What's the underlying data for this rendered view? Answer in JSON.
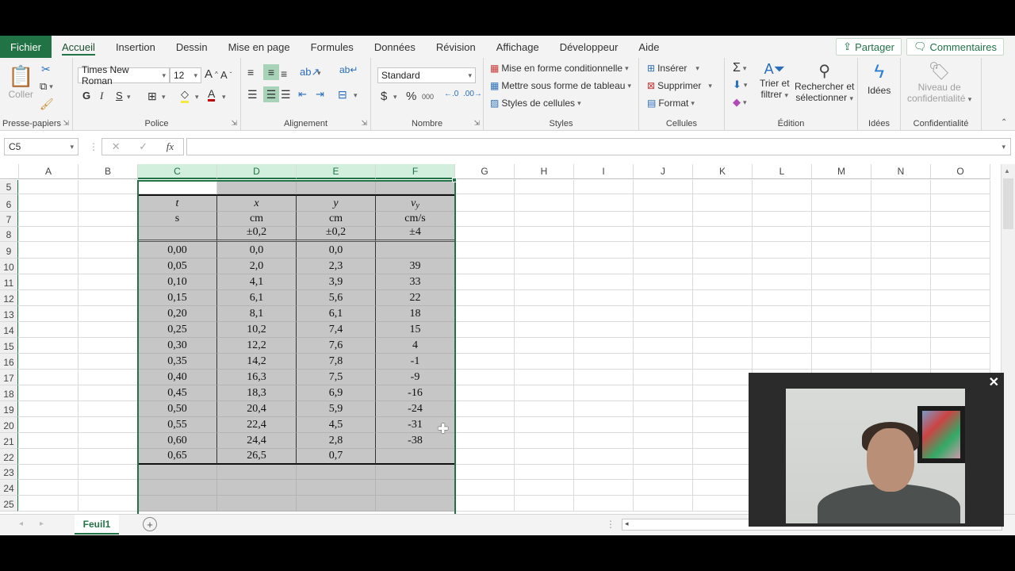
{
  "tabs": {
    "file": "Fichier",
    "items": [
      "Accueil",
      "Insertion",
      "Dessin",
      "Mise en page",
      "Formules",
      "Données",
      "Révision",
      "Affichage",
      "Développeur",
      "Aide"
    ],
    "active": "Accueil",
    "share": "Partager",
    "comments": "Commentaires"
  },
  "ribbon": {
    "clipboard": {
      "label": "Presse-papiers",
      "paste": "Coller"
    },
    "font": {
      "label": "Police",
      "family": "Times New Roman",
      "size": "12",
      "bold": "G",
      "italic": "I",
      "underline": "S"
    },
    "alignment": {
      "label": "Alignement"
    },
    "number": {
      "label": "Nombre",
      "format": "Standard",
      "currency": "$",
      "percent": "%",
      "thousands": "000"
    },
    "styles": {
      "label": "Styles",
      "conditional": "Mise en forme conditionnelle",
      "table": "Mettre sous forme de tableau",
      "cell_styles": "Styles de cellules"
    },
    "cells": {
      "label": "Cellules",
      "insert": "Insérer",
      "delete": "Supprimer",
      "format": "Format"
    },
    "editing": {
      "label": "Édition",
      "sort_line1": "Trier et",
      "sort_line2": "filtrer",
      "find_line1": "Rechercher et",
      "find_line2": "sélectionner"
    },
    "ideas": {
      "label": "Idées",
      "button": "Idées"
    },
    "sensitivity": {
      "label": "Confidentialité",
      "line1": "Niveau de",
      "line2": "confidentialité"
    }
  },
  "formula_bar": {
    "name_box": "C5",
    "fx": "fx",
    "value": ""
  },
  "grid": {
    "columns": [
      "A",
      "B",
      "C",
      "D",
      "E",
      "F",
      "G",
      "H",
      "I",
      "J",
      "K",
      "L",
      "M",
      "N",
      "O"
    ],
    "selected_columns": [
      "C",
      "D",
      "E",
      "F"
    ],
    "rows": [
      "5",
      "6",
      "7",
      "8",
      "9",
      "10",
      "11",
      "12",
      "13",
      "14",
      "15",
      "16",
      "17",
      "18",
      "19",
      "20",
      "21",
      "22",
      "23",
      "24",
      "25"
    ]
  },
  "table": {
    "headers": [
      "t",
      "x",
      "y",
      "v_y"
    ],
    "header_main": [
      "t",
      "x",
      "y",
      "v"
    ],
    "header_sub": [
      "",
      "",
      "",
      "y"
    ],
    "units": [
      "s",
      "cm",
      "cm",
      "cm/s"
    ],
    "uncertainty": [
      "",
      "±0,2",
      "±0,2",
      "±4"
    ],
    "rows": [
      [
        "0,00",
        "0,0",
        "0,0",
        ""
      ],
      [
        "0,05",
        "2,0",
        "2,3",
        "39"
      ],
      [
        "0,10",
        "4,1",
        "3,9",
        "33"
      ],
      [
        "0,15",
        "6,1",
        "5,6",
        "22"
      ],
      [
        "0,20",
        "8,1",
        "6,1",
        "18"
      ],
      [
        "0,25",
        "10,2",
        "7,4",
        "15"
      ],
      [
        "0,30",
        "12,2",
        "7,6",
        "4"
      ],
      [
        "0,35",
        "14,2",
        "7,8",
        "-1"
      ],
      [
        "0,40",
        "16,3",
        "7,5",
        "-9"
      ],
      [
        "0,45",
        "18,3",
        "6,9",
        "-16"
      ],
      [
        "0,50",
        "20,4",
        "5,9",
        "-24"
      ],
      [
        "0,55",
        "22,4",
        "4,5",
        "-31"
      ],
      [
        "0,60",
        "24,4",
        "2,8",
        "-38"
      ],
      [
        "0,65",
        "26,5",
        "0,7",
        ""
      ]
    ]
  },
  "sheets": {
    "active": "Feuil1"
  },
  "webcam": {
    "close": "✕"
  }
}
